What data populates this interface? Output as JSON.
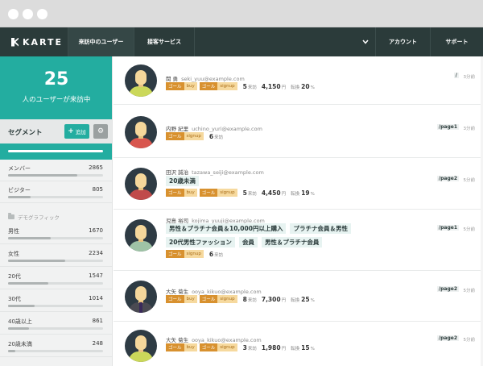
{
  "nav": {
    "brand": "KARTE",
    "tabs": [
      {
        "label": "来訪中のユーザー"
      },
      {
        "label": "接客サービス"
      }
    ],
    "account": "アカウント",
    "support": "サポート"
  },
  "visitors": {
    "count": "25",
    "label": "人のユーザーが来訪中"
  },
  "segment": {
    "title": "セグメント",
    "add_label": "追加",
    "group_label": "デモグラフィック",
    "items": [
      {
        "name": "メンバー",
        "value": "2865",
        "fill": 0.73
      },
      {
        "name": "ビジター",
        "value": "805",
        "fill": 0.24
      },
      {
        "name": "男性",
        "value": "1670",
        "fill": 0.45
      },
      {
        "name": "女性",
        "value": "2234",
        "fill": 0.6
      },
      {
        "name": "20代",
        "value": "1547",
        "fill": 0.42
      },
      {
        "name": "30代",
        "value": "1014",
        "fill": 0.28
      },
      {
        "name": "40歳以上",
        "value": "861",
        "fill": 0.22
      },
      {
        "name": "20歳未満",
        "value": "248",
        "fill": 0.08
      }
    ]
  },
  "users": [
    {
      "name": "関 勇",
      "email": "seki_yuu@example.com",
      "chips": [
        {
          "k": "ゴール",
          "v": "buy"
        },
        {
          "k": "ゴール",
          "v": "signup"
        }
      ],
      "visits": "5",
      "visits_unit": "来訪",
      "amount": "4,150",
      "amount_unit": "円",
      "rate_label": "転換",
      "rate": "20",
      "rate_unit": "%",
      "tags": [],
      "page": "/",
      "time": "3分前",
      "shirt": "#cbd85a",
      "tie": false
    },
    {
      "name": "内野 紀里",
      "email": "uchino_yuri@example.com",
      "chips": [
        {
          "k": "ゴール",
          "v": "signup"
        }
      ],
      "visits": "6",
      "visits_unit": "来訪",
      "tags": [],
      "page": "/page1",
      "time": "3分前",
      "shirt": "#d8564e",
      "tie": false
    },
    {
      "name": "田沢 誠治",
      "email": "tazawa_seiji@example.com",
      "chips": [
        {
          "k": "ゴール",
          "v": "buy"
        },
        {
          "k": "ゴール",
          "v": "signup"
        }
      ],
      "visits": "5",
      "visits_unit": "来訪",
      "amount": "4,450",
      "amount_unit": "円",
      "rate_label": "転換",
      "rate": "19",
      "rate_unit": "%",
      "tags": [
        "20歳未満"
      ],
      "page": "/page2",
      "time": "5分前",
      "shirt": "#c04a4a",
      "tie": false
    },
    {
      "name": "児島 裕司",
      "email": "kojima_yuuji@example.com",
      "chips": [
        {
          "k": "ゴール",
          "v": "signup"
        }
      ],
      "visits": "6",
      "visits_unit": "来訪",
      "tags": [
        "男性＆プラチナ会員＆10,000円以上購入",
        "プラチナ会員＆男性",
        "20代男性ファッション",
        "会員",
        "男性＆プラチナ会員"
      ],
      "page": "/page1",
      "time": "5分前",
      "shirt": "#9fc3a6",
      "tie": false
    },
    {
      "name": "大矢 菊生",
      "email": "ooya_kikuo@example.com",
      "chips": [
        {
          "k": "ゴール",
          "v": "buy"
        },
        {
          "k": "ゴール",
          "v": "signup"
        }
      ],
      "visits": "8",
      "visits_unit": "来訪",
      "amount": "7,300",
      "amount_unit": "円",
      "rate_label": "転換",
      "rate": "25",
      "rate_unit": "%",
      "tags": [],
      "page": "/page2",
      "time": "5分前",
      "shirt": "#4a4a52",
      "tie": true
    },
    {
      "name": "大矢 菊生",
      "email": "ooya_kikuo@example.com",
      "chips": [
        {
          "k": "ゴール",
          "v": "buy"
        },
        {
          "k": "ゴール",
          "v": "signup"
        }
      ],
      "visits": "3",
      "visits_unit": "来訪",
      "amount": "1,980",
      "amount_unit": "円",
      "rate_label": "転換",
      "rate": "15",
      "rate_unit": "%",
      "tags": [],
      "page": "/page2",
      "time": "5分前",
      "shirt": "#cbd85a",
      "tie": false
    }
  ]
}
